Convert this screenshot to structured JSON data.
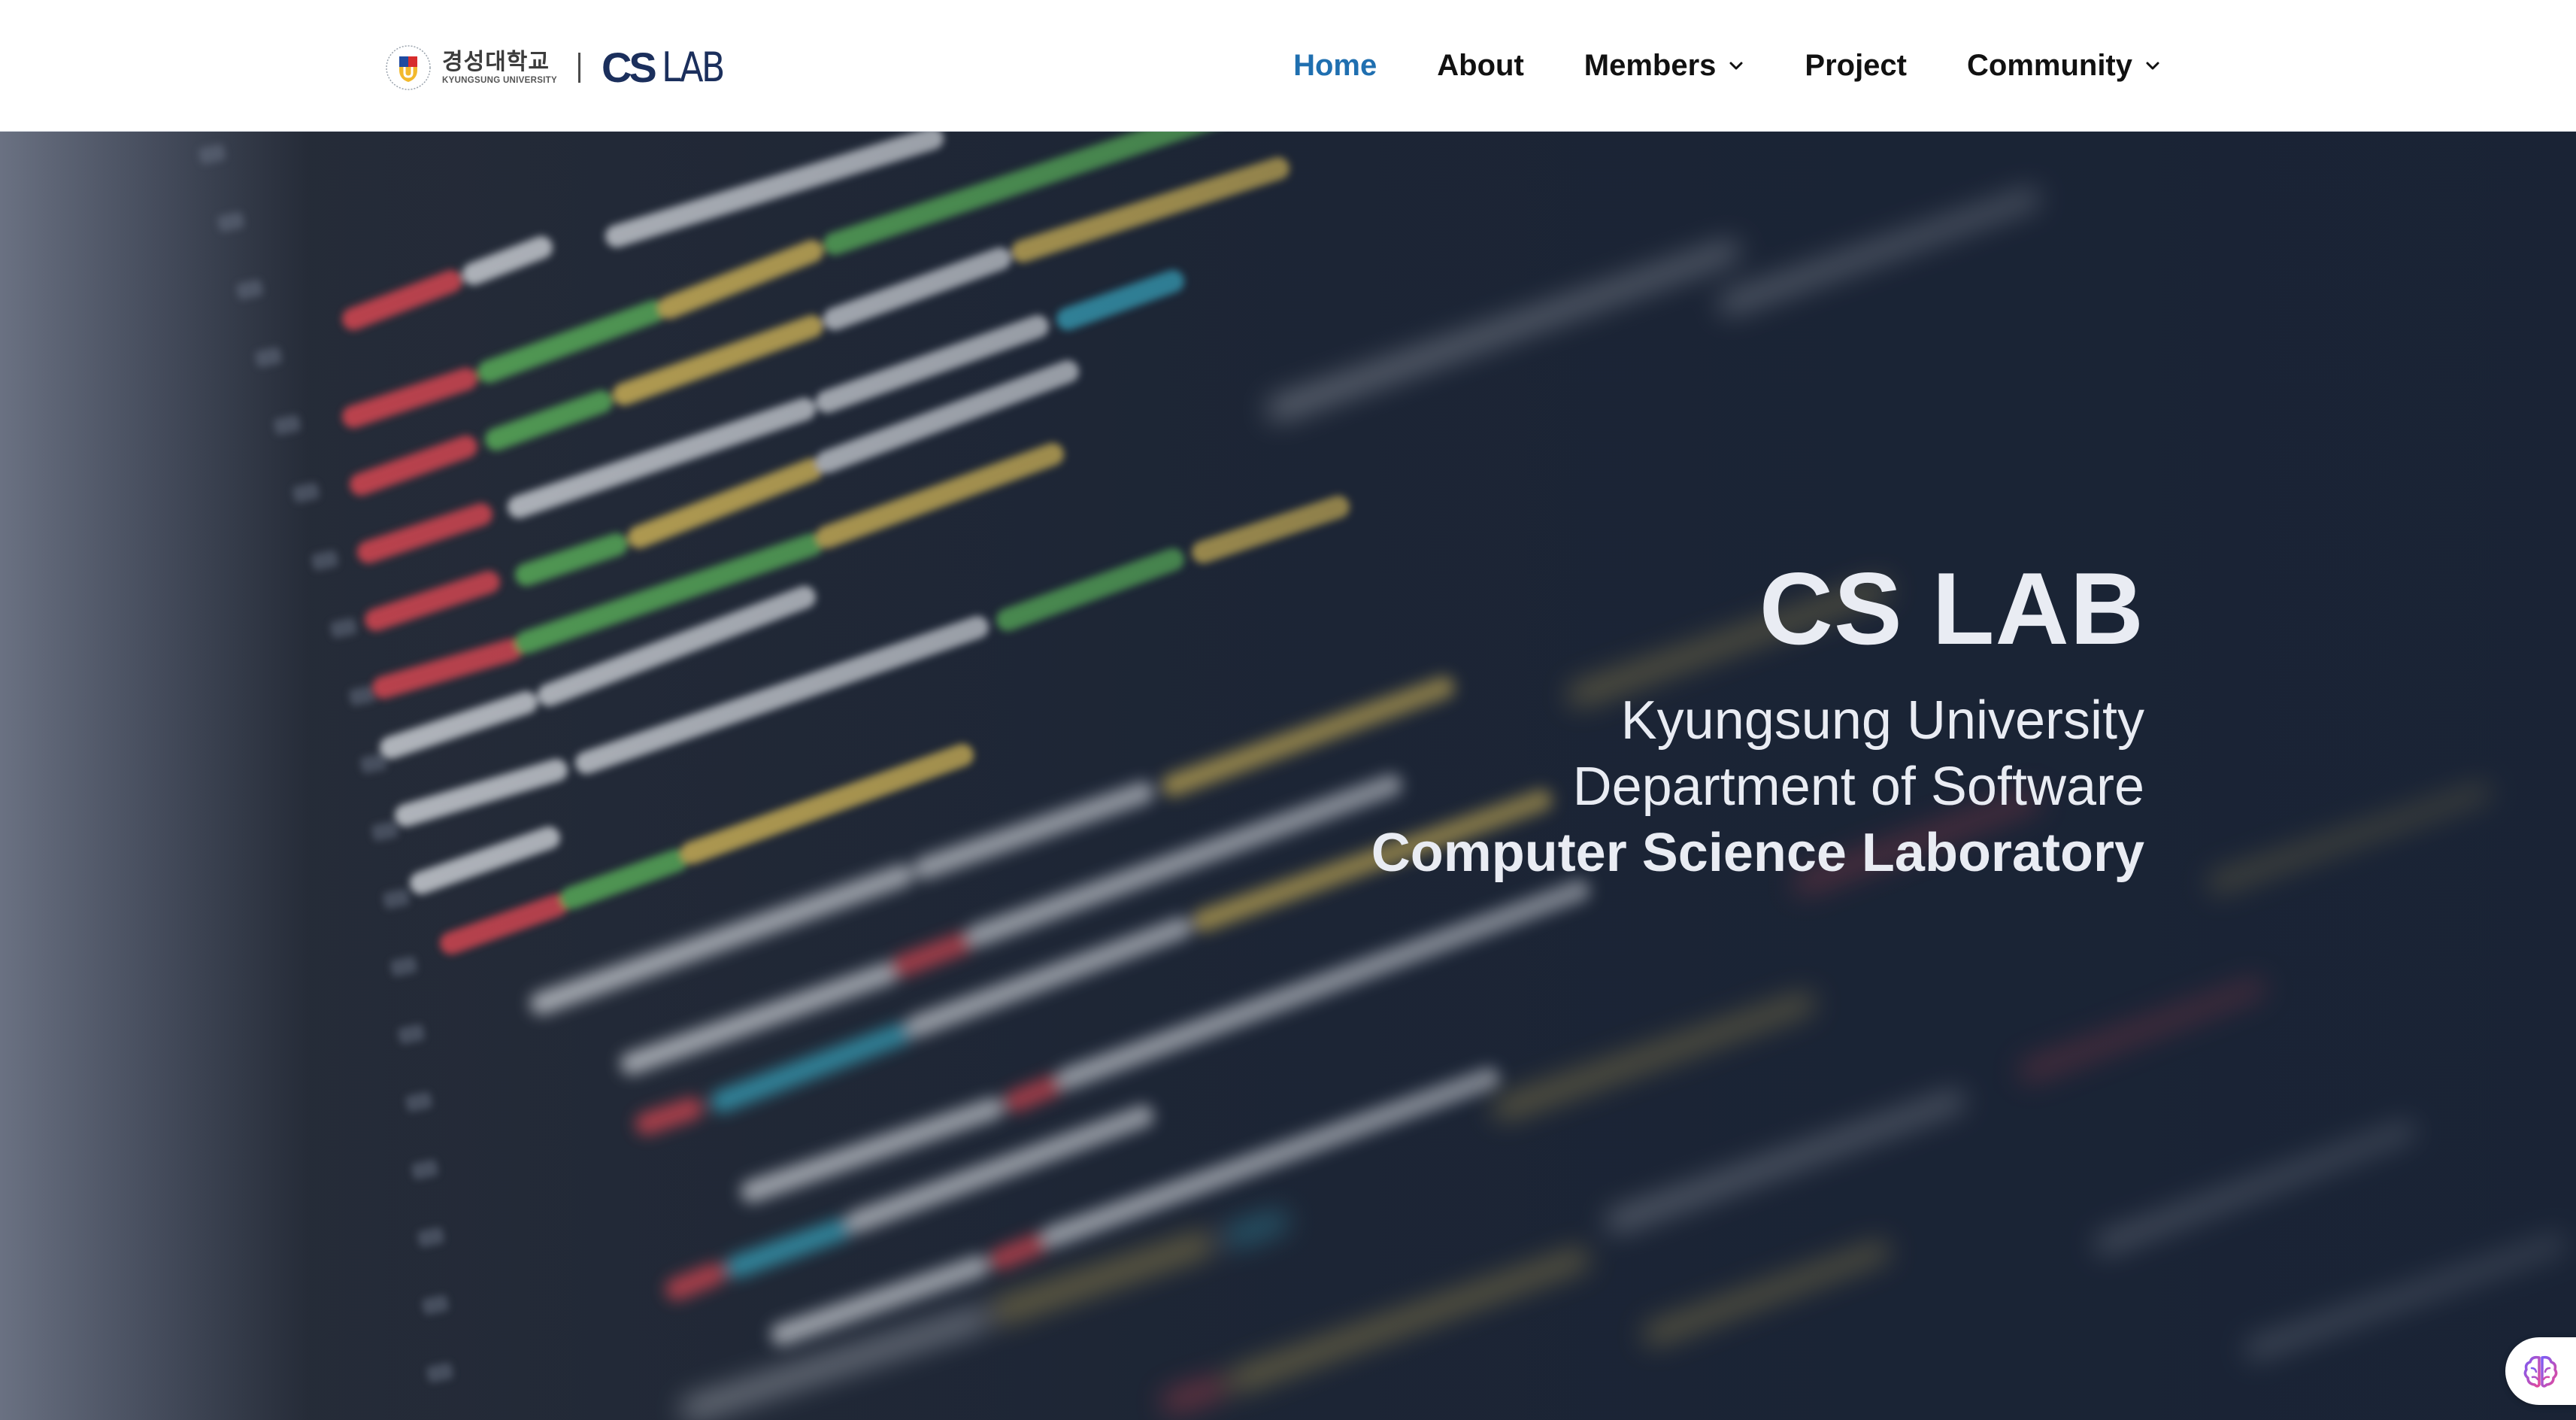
{
  "brand": {
    "university_korean": "경성대학교",
    "university_english": "KYUNGSUNG UNIVERSITY",
    "lab_logo_cs": "CS",
    "lab_logo_lab": "LAB"
  },
  "nav": {
    "items": [
      {
        "label": "Home",
        "active": true,
        "has_dropdown": false
      },
      {
        "label": "About",
        "active": false,
        "has_dropdown": false
      },
      {
        "label": "Members",
        "active": false,
        "has_dropdown": true
      },
      {
        "label": "Project",
        "active": false,
        "has_dropdown": false
      },
      {
        "label": "Community",
        "active": false,
        "has_dropdown": true
      }
    ]
  },
  "hero": {
    "title": "CS LAB",
    "line1": "Kyungsung University",
    "line2": "Department of Software",
    "line3": "Computer Science Laboratory"
  },
  "colors": {
    "accent": "#1f6fb0",
    "header_bg": "#ffffff",
    "hero_overlay": "#1a2436",
    "hero_text": "#e9ecf3"
  },
  "icons": {
    "nav_dropdown": "chevron-down-icon",
    "widget": "brain-icon"
  }
}
